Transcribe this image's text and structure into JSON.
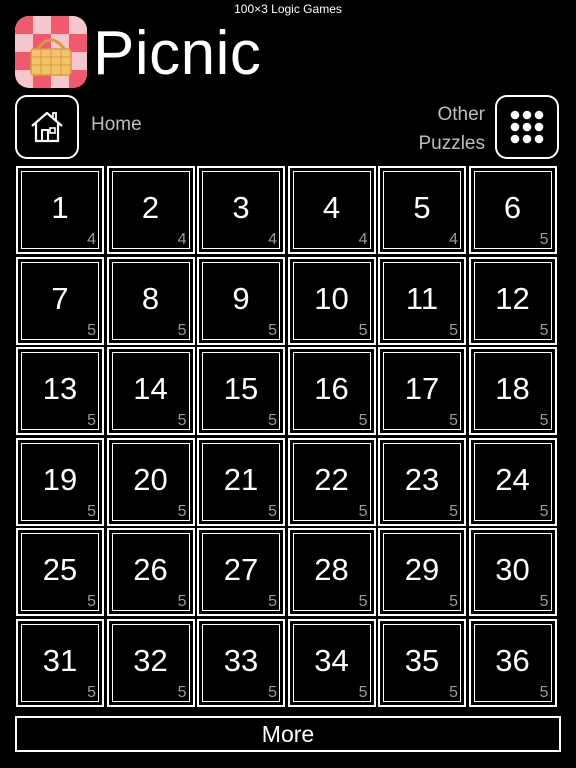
{
  "statusbar": {
    "title": "100×3 Logic Games"
  },
  "header": {
    "title": "Picnic",
    "app_icon": "picnic-basket-icon"
  },
  "nav": {
    "home_label": "Home",
    "home_icon": "house-icon",
    "other_line1": "Other",
    "other_line2": "Puzzles",
    "grid_icon": "nine-dots-grid-icon"
  },
  "puzzles": [
    {
      "number": "1",
      "difficulty": "4"
    },
    {
      "number": "2",
      "difficulty": "4"
    },
    {
      "number": "3",
      "difficulty": "4"
    },
    {
      "number": "4",
      "difficulty": "4"
    },
    {
      "number": "5",
      "difficulty": "4"
    },
    {
      "number": "6",
      "difficulty": "5"
    },
    {
      "number": "7",
      "difficulty": "5"
    },
    {
      "number": "8",
      "difficulty": "5"
    },
    {
      "number": "9",
      "difficulty": "5"
    },
    {
      "number": "10",
      "difficulty": "5"
    },
    {
      "number": "11",
      "difficulty": "5"
    },
    {
      "number": "12",
      "difficulty": "5"
    },
    {
      "number": "13",
      "difficulty": "5"
    },
    {
      "number": "14",
      "difficulty": "5"
    },
    {
      "number": "15",
      "difficulty": "5"
    },
    {
      "number": "16",
      "difficulty": "5"
    },
    {
      "number": "17",
      "difficulty": "5"
    },
    {
      "number": "18",
      "difficulty": "5"
    },
    {
      "number": "19",
      "difficulty": "5"
    },
    {
      "number": "20",
      "difficulty": "5"
    },
    {
      "number": "21",
      "difficulty": "5"
    },
    {
      "number": "22",
      "difficulty": "5"
    },
    {
      "number": "23",
      "difficulty": "5"
    },
    {
      "number": "24",
      "difficulty": "5"
    },
    {
      "number": "25",
      "difficulty": "5"
    },
    {
      "number": "26",
      "difficulty": "5"
    },
    {
      "number": "27",
      "difficulty": "5"
    },
    {
      "number": "28",
      "difficulty": "5"
    },
    {
      "number": "29",
      "difficulty": "5"
    },
    {
      "number": "30",
      "difficulty": "5"
    },
    {
      "number": "31",
      "difficulty": "5"
    },
    {
      "number": "32",
      "difficulty": "5"
    },
    {
      "number": "33",
      "difficulty": "5"
    },
    {
      "number": "34",
      "difficulty": "5"
    },
    {
      "number": "35",
      "difficulty": "5"
    },
    {
      "number": "36",
      "difficulty": "5"
    }
  ],
  "more_label": "More",
  "colors": {
    "background": "#000000",
    "foreground": "#ffffff",
    "muted": "#9a9a9a",
    "checker_red": "#f05a6e",
    "checker_pink": "#f7c6cc",
    "basket": "#f2c46a"
  }
}
